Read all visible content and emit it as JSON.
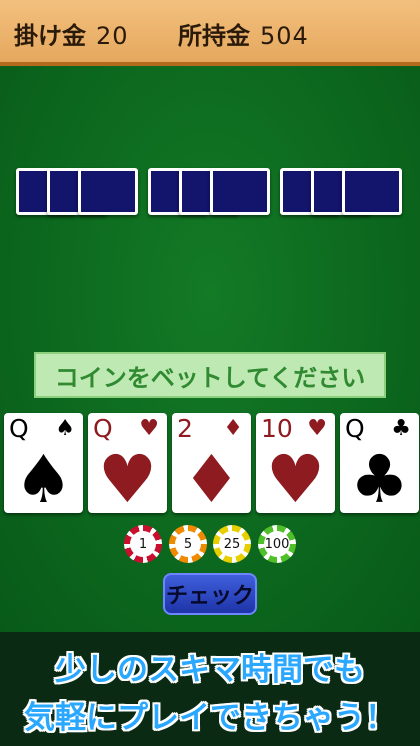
{
  "header": {
    "bet_label": "掛け金",
    "bet_value": "20",
    "balance_label": "所持金",
    "balance_value": "504"
  },
  "dealer": {
    "face_down_count": 9
  },
  "message": "コインをベットしてください",
  "player_cards": [
    {
      "rank": "Q",
      "suit": "♠",
      "suit_name": "spade",
      "color": "black"
    },
    {
      "rank": "Q",
      "suit": "♥",
      "suit_name": "heart",
      "color": "red"
    },
    {
      "rank": "2",
      "suit": "♦",
      "suit_name": "diamond",
      "color": "red"
    },
    {
      "rank": "10",
      "suit": "♥",
      "suit_name": "heart",
      "color": "red"
    },
    {
      "rank": "Q",
      "suit": "♣",
      "suit_name": "club",
      "color": "black"
    }
  ],
  "chips": [
    {
      "label": "1",
      "color": "#c8102e"
    },
    {
      "label": "5",
      "color": "#f08a00"
    },
    {
      "label": "25",
      "color": "#e8d000"
    },
    {
      "label": "100",
      "color": "#4fbf2a"
    }
  ],
  "check_button": "チェック",
  "promo": {
    "line1": "少しのスキマ時間でも",
    "line2": "気軽にプレイできちゃう！"
  },
  "colors": {
    "felt": "#0f6a22",
    "header": "#eeb46c",
    "card_back": "#13146b",
    "red_suit": "#8e1b20",
    "message_bg": "#bfe9b2",
    "message_text": "#2f8a32",
    "button": "#2a44c4",
    "promo_text": "#2aa7ff"
  }
}
